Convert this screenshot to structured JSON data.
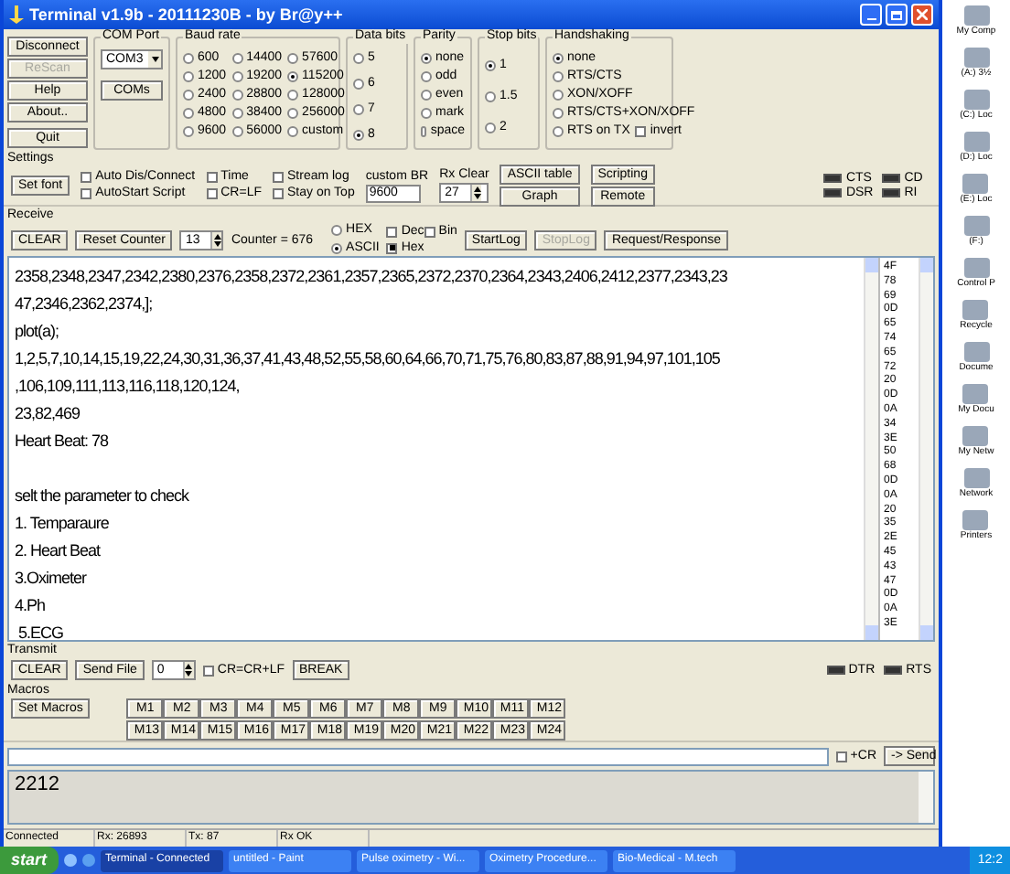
{
  "window": {
    "title": "Terminal v1.9b - 20111230B - by Br@y++"
  },
  "side_buttons": [
    {
      "label": "Disconnect",
      "disabled": false
    },
    {
      "label": "ReScan",
      "disabled": true
    },
    {
      "label": "Help",
      "disabled": false
    },
    {
      "label": "About..",
      "disabled": false
    },
    {
      "label": "Quit",
      "disabled": false
    }
  ],
  "com_port": {
    "label": "COM Port",
    "value": "COM3",
    "button": "COMs"
  },
  "baud_rate": {
    "label": "Baud rate",
    "options": [
      {
        "label": "600",
        "selected": false
      },
      {
        "label": "1200",
        "selected": false
      },
      {
        "label": "2400",
        "selected": false
      },
      {
        "label": "4800",
        "selected": false
      },
      {
        "label": "9600",
        "selected": false
      },
      {
        "label": "14400",
        "selected": false
      },
      {
        "label": "19200",
        "selected": false
      },
      {
        "label": "28800",
        "selected": false
      },
      {
        "label": "38400",
        "selected": false
      },
      {
        "label": "56000",
        "selected": false
      },
      {
        "label": "57600",
        "selected": false
      },
      {
        "label": "115200",
        "selected": true
      },
      {
        "label": "128000",
        "selected": false
      },
      {
        "label": "256000",
        "selected": false
      },
      {
        "label": "custom",
        "selected": false
      }
    ]
  },
  "data_bits": {
    "label": "Data bits",
    "options": [
      {
        "label": "5",
        "selected": false
      },
      {
        "label": "6",
        "selected": false
      },
      {
        "label": "7",
        "selected": false
      },
      {
        "label": "8",
        "selected": true
      }
    ]
  },
  "parity": {
    "label": "Parity",
    "options": [
      {
        "label": "none",
        "selected": true
      },
      {
        "label": "odd",
        "selected": false
      },
      {
        "label": "even",
        "selected": false
      },
      {
        "label": "mark",
        "selected": false
      },
      {
        "label": "space",
        "selected": false
      }
    ]
  },
  "stop_bits": {
    "label": "Stop bits",
    "options": [
      {
        "label": "1",
        "selected": true
      },
      {
        "label": "1.5",
        "selected": false
      },
      {
        "label": "2",
        "selected": false
      }
    ]
  },
  "handshaking": {
    "label": "Handshaking",
    "options": [
      {
        "label": "none",
        "selected": true
      },
      {
        "label": "RTS/CTS",
        "selected": false
      },
      {
        "label": "XON/XOFF",
        "selected": false
      },
      {
        "label": "RTS/CTS+XON/XOFF",
        "selected": false
      },
      {
        "label": "RTS on TX",
        "selected": false
      }
    ],
    "invert": {
      "label": "invert",
      "checked": false
    }
  },
  "settings": {
    "label": "Settings",
    "font_button": "Set font",
    "checks": [
      {
        "label": "Auto Dis/Connect",
        "checked": false
      },
      {
        "label": "AutoStart Script",
        "checked": false
      },
      {
        "label": "Time",
        "checked": false
      },
      {
        "label": "CR=LF",
        "checked": false
      },
      {
        "label": "Stream log",
        "checked": false
      },
      {
        "label": "Stay on Top",
        "checked": false
      }
    ],
    "custom_br": {
      "label": "custom BR",
      "value": "9600"
    },
    "rx_clear": {
      "label": "Rx Clear",
      "value": "27"
    },
    "buttons": [
      [
        "ASCII table",
        "Graph"
      ],
      [
        "Scripting",
        "Remote"
      ]
    ],
    "leds": [
      {
        "label": "CTS",
        "on": false
      },
      {
        "label": "CD",
        "on": false
      },
      {
        "label": "DSR",
        "on": false
      },
      {
        "label": "RI",
        "on": false
      }
    ]
  },
  "receive": {
    "label": "Receive",
    "clear": "CLEAR",
    "reset": "Reset Counter",
    "spin": "13",
    "counter": "Counter = 676",
    "modes": [
      {
        "label": "HEX",
        "selected": false
      },
      {
        "label": "ASCII",
        "selected": true
      }
    ],
    "checks": [
      {
        "label": "Dec",
        "checked": false
      },
      {
        "label": "Hex",
        "checked": true
      },
      {
        "label": "Bin",
        "checked": false
      }
    ],
    "buttons": [
      {
        "label": "StartLog",
        "disabled": false
      },
      {
        "label": "StopLog",
        "disabled": true
      },
      {
        "label": "Request/Response",
        "disabled": false
      }
    ],
    "lines": [
      "2358,2348,2347,2342,2380,2376,2358,2372,2361,2357,2365,2372,2370,2364,2343,2406,2412,2377,2343,23",
      "47,2346,2362,2374,];",
      "plot(a);",
      "1,2,5,7,10,14,15,19,22,24,30,31,36,37,41,43,48,52,55,58,60,64,66,70,71,75,76,80,83,87,88,91,94,97,101,105",
      ",106,109,111,113,116,118,120,124,",
      "23,82,469",
      "Heart Beat: 78"
    ],
    "lines_after_gap": [
      "selt the parameter to check",
      "1. Temparaure",
      "2. Heart Beat",
      "3.Oximeter",
      "4.Ph",
      " 5.ECG"
    ],
    "hex": [
      "4F",
      "78",
      "69",
      "0D",
      "65",
      "74",
      "65",
      "72",
      "20",
      "0D",
      "0A",
      "34",
      "3E",
      "50",
      "68",
      "0D",
      "0A",
      "20",
      "35",
      "2E",
      "45",
      "43",
      "47",
      "0D",
      "0A",
      "3E"
    ]
  },
  "transmit": {
    "label": "Transmit",
    "clear": "CLEAR",
    "send_file": "Send File",
    "spin": "0",
    "crlf": {
      "label": "CR=CR+LF",
      "checked": false
    },
    "break": "BREAK",
    "leds": [
      {
        "label": "DTR",
        "on": false
      },
      {
        "label": "RTS",
        "on": false
      }
    ]
  },
  "macros": {
    "label": "Macros",
    "set": "Set Macros",
    "items": [
      "M1",
      "M2",
      "M3",
      "M4",
      "M5",
      "M6",
      "M7",
      "M8",
      "M9",
      "M10",
      "M11",
      "M12",
      "M13",
      "M14",
      "M15",
      "M16",
      "M17",
      "M18",
      "M19",
      "M20",
      "M21",
      "M22",
      "M23",
      "M24"
    ]
  },
  "send": {
    "cr": {
      "label": "+CR",
      "checked": false
    },
    "button": "-> Send"
  },
  "transmit_text": "2212",
  "status_bar": [
    "Connected",
    "Rx: 26893",
    "Tx: 87",
    "Rx OK"
  ],
  "desktop_icons": [
    "My Comp",
    "(A:) 3½",
    "(C:) Loc",
    "(D:) Loc",
    "(E:) Loc",
    "(F:)",
    "Control P",
    "Recycle",
    "Docume",
    "My Docu",
    "My Netw",
    "Network",
    "Printers"
  ],
  "taskbar": {
    "start": "start",
    "tasks": [
      {
        "label": "Terminal - Connected",
        "selected": true
      },
      {
        "label": "untitled - Paint",
        "selected": false
      },
      {
        "label": "Pulse oximetry - Wi...",
        "selected": false
      },
      {
        "label": "Oximetry Procedure...",
        "selected": false
      },
      {
        "label": "Bio-Medical - M.tech",
        "selected": false
      }
    ],
    "clock": "12:2"
  }
}
